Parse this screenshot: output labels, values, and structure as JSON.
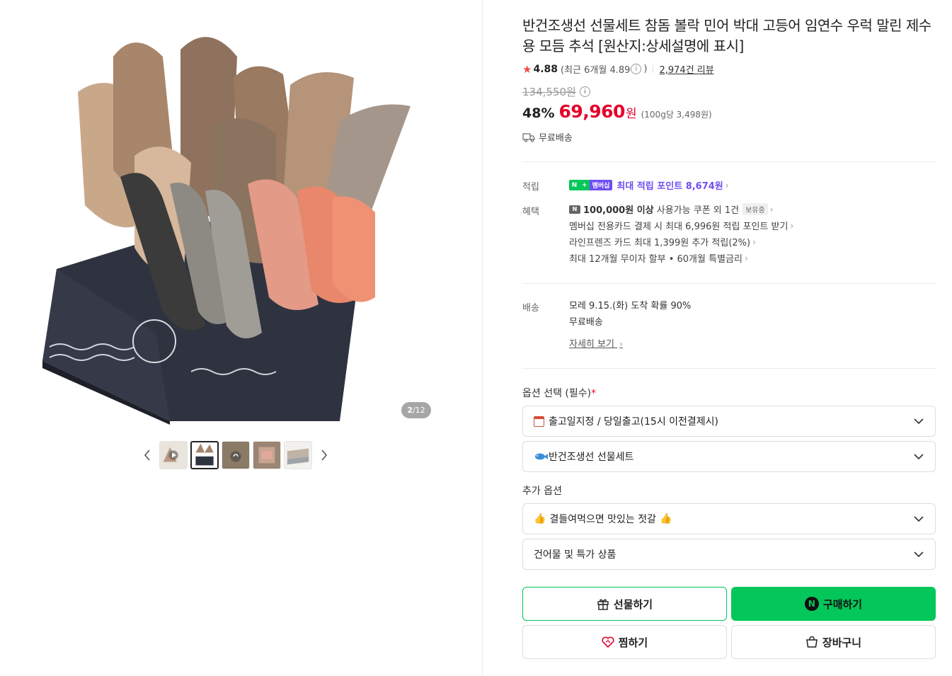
{
  "product": {
    "title": "반건조생선 선물세트 참돔 볼락 민어 박대 고등어 임연수 우럭 말린 제수용 모듬 추석 [원산지:상세설명에 표시]",
    "rating": "4.88",
    "recent_rating": "(최근 6개월 4.89",
    "recent_close": ")",
    "review_count": "2,974건 리뷰",
    "original_price": "134,550원",
    "discount": "48%",
    "price": "69,960",
    "price_unit": "원",
    "unit_price": "(100g당 3,498원)",
    "free_shipping": "무료배송"
  },
  "gallery": {
    "counter_current": "2",
    "counter_total": "/12",
    "prev_icon": "chevron-left-icon",
    "next_icon": "chevron-right-icon"
  },
  "points": {
    "label": "적립",
    "badge_n": "N",
    "badge_plus": "+",
    "badge_member": "멤버십",
    "text": "최대 적립 포인트 8,674원"
  },
  "benefits": {
    "label": "혜택",
    "coupon_icon_text": "N",
    "coupon_bold": "100,000원 이상",
    "coupon_text": " 사용가능 쿠폰 외 1건",
    "coupon_badge": "보유중",
    "line2": "멤버십 전용카드 결제 시 최대 6,996원 적립 포인트 받기",
    "line3": "라인프렌즈 카드 최대 1,399원 추가 적립(2%)",
    "line4": "최대 12개월 무이자 할부 • 60개월 특별금리"
  },
  "delivery": {
    "label": "배송",
    "arrival": "모레 9.15.(화) 도착 확률 90%",
    "fee": "무료배송",
    "detail_link": "자세히 보기"
  },
  "options": {
    "title": "옵션 선택 (필수)",
    "required_mark": "*",
    "select1": "출고일지정 / 당일출고(15시 이전결제시)",
    "select2": "반건조생선 선물세트",
    "extra_title": "추가 옵션",
    "select3": "결들여먹으면 맛있는 젓갈",
    "select4": "건어물 및 특가 상품"
  },
  "buttons": {
    "gift": "선물하기",
    "buy_icon": "N",
    "buy": "구매하기",
    "wish": "찜하기",
    "cart": "장바구니"
  },
  "colors": {
    "accent_green": "#03c75a",
    "price_red": "#e5002b",
    "member_purple": "#6f4ef2"
  }
}
